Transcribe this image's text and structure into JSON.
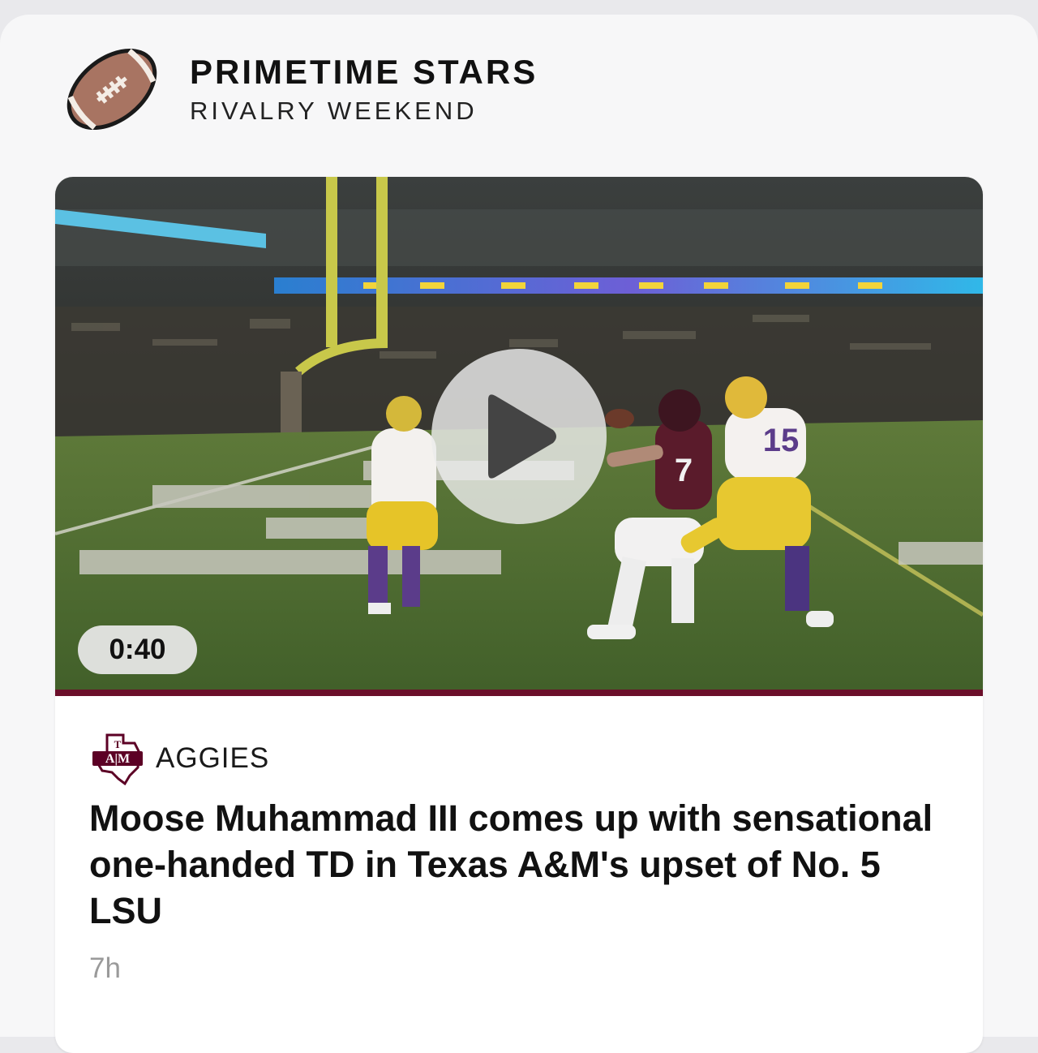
{
  "header": {
    "title": "PRIMETIME STARS",
    "subtitle": "RIVALRY WEEKEND",
    "icon": "football-icon"
  },
  "story": {
    "video": {
      "duration": "0:40",
      "accent_color": "#6b0f2a"
    },
    "team": {
      "name": "AGGIES",
      "logo": "texas-am-logo",
      "color": "#5c0025"
    },
    "headline": "Moose Muhammad III comes up with sensational one-handed TD in Texas A&M's upset of No. 5 LSU",
    "time_ago": "7h",
    "jerseys": {
      "receiver_number": "7",
      "defender_number": "15"
    }
  }
}
